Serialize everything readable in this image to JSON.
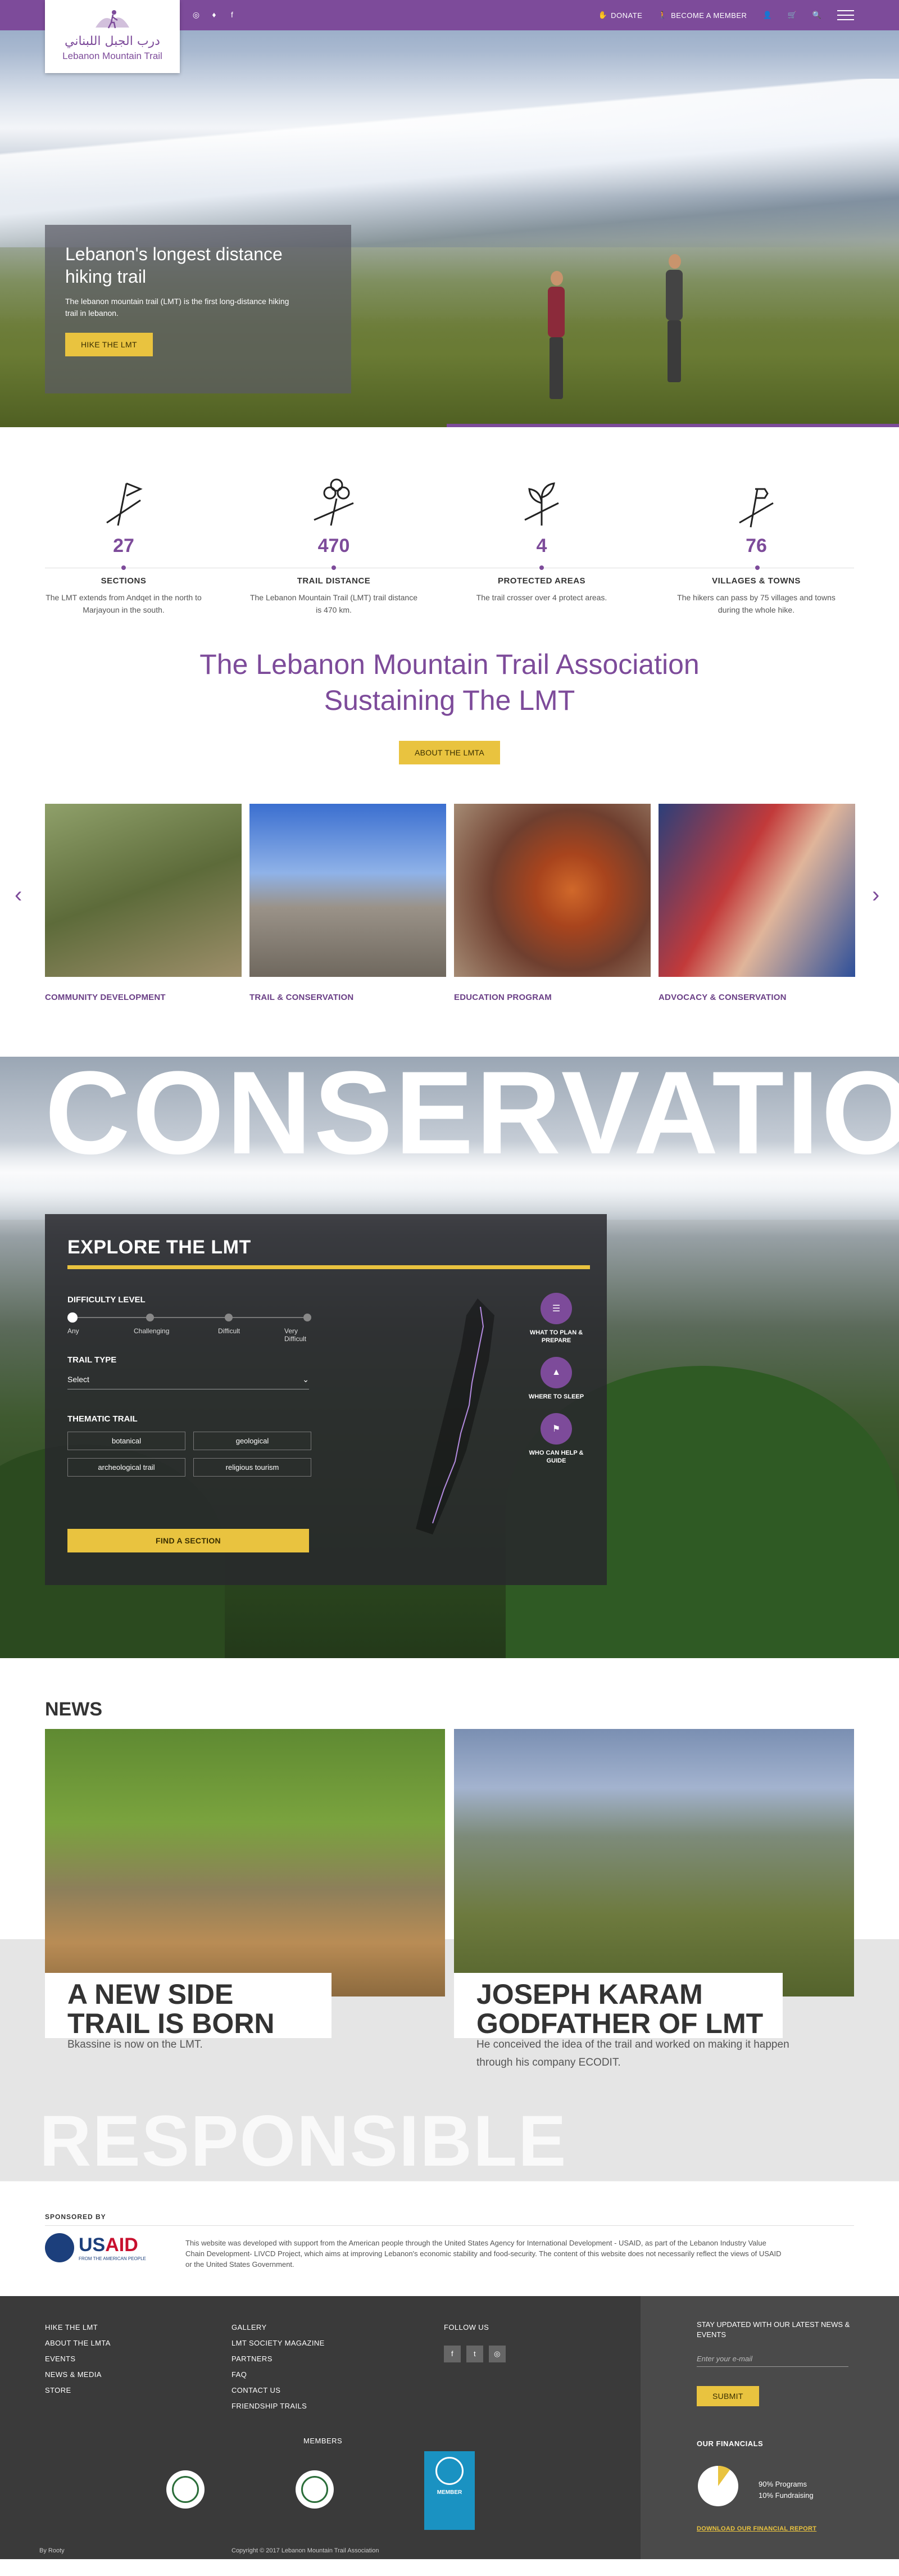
{
  "header": {
    "logo_arabic": "درب الجبل اللبناني",
    "logo_text": "Lebanon Mountain Trail",
    "donate": "DONATE",
    "become_member": "BECOME A MEMBER"
  },
  "hero": {
    "title": "Lebanon's longest distance hiking  trail",
    "body": "The lebanon mountain trail (LMT) is the first long-distance hiking trail in lebanon.",
    "button": "HIKE THE LMT"
  },
  "stats": [
    {
      "num": "27",
      "label": "SECTIONS",
      "desc": "The LMT extends from Andqet in the north  to Marjayoun in the south."
    },
    {
      "num": "470",
      "label": "TRAIL DISTANCE",
      "desc": "The Lebanon Mountain Trail (LMT) trail distance is 470 km."
    },
    {
      "num": "4",
      "label": "PROTECTED AREAS",
      "desc": "The trail crosser over 4 protect areas."
    },
    {
      "num": "76",
      "label": "VILLAGES & TOWNS",
      "desc": "The hikers can pass by 75 villages and towns during the whole hike."
    }
  ],
  "assoc": {
    "line1": "The Lebanon Mountain Trail Association",
    "line2": "Sustaining The LMT",
    "button": "ABOUT THE LMTA"
  },
  "programs": [
    {
      "label": "COMMUNITY DEVELOPMENT"
    },
    {
      "label": "TRAIL & CONSERVATION"
    },
    {
      "label": "EDUCATION PROGRAM"
    },
    {
      "label": "ADVOCACY & CONSERVATION"
    }
  ],
  "explore": {
    "bg_word": "CONSERVATION",
    "title": "EXPLORE THE LMT",
    "difficulty_label": "DIFFICULTY LEVEL",
    "difficulty": [
      "Any",
      "Challenging",
      "Difficult",
      "Very Difficult"
    ],
    "trail_type_label": "TRAIL TYPE",
    "trail_type_value": "Select",
    "thematic_label": "THEMATIC TRAIL",
    "thematic": [
      "botanical",
      "geological",
      "archeological trail",
      "religious tourism"
    ],
    "button": "FIND A SECTION",
    "side": [
      "WHAT TO PLAN & PREPARE",
      "WHERE TO SLEEP",
      "WHO CAN HELP & GUIDE"
    ]
  },
  "news": {
    "heading": "NEWS",
    "items": [
      {
        "title": "A NEW SIDE TRAIL IS BORN",
        "sub": "Bkassine is now on the LMT."
      },
      {
        "title": "JOSEPH KARAM GODFATHER OF LMT",
        "sub": "He conceived the idea of the trail and worked on making it happen through his company ECODIT."
      }
    ],
    "bg_word": "RESPONSIBLE TOURISM"
  },
  "sponsor": {
    "label": "SPONSORED BY",
    "usaid_a": "US",
    "usaid_b": "AID",
    "usaid_tag": "FROM THE AMERICAN PEOPLE",
    "text": "This website was developed with support from the American people through the United States Agency for International Development - USAID, as part of the Lebanon Industry Value Chain Development- LIVCD Project, which aims at improving Lebanon's economic stability and food-security. The content of this website does not necessarily reflect the views of USAID or the United States Government."
  },
  "footer": {
    "col1": [
      "HIKE THE LMT",
      "ABOUT THE LMTA",
      "EVENTS",
      "NEWS & MEDIA",
      "STORE"
    ],
    "col2": [
      "GALLERY",
      "LMT SOCIETY MAGAZINE",
      "PARTNERS",
      "FAQ",
      "CONTACT US",
      "FRIENDSHIP TRAILS"
    ],
    "follow": "FOLLOW US",
    "updated": "STAY UPDATED WITH OUR LATEST NEWS & EVENTS",
    "email_placeholder": "Enter your e-mail",
    "submit": "SUBMIT",
    "financials": "OUR FINANCIALS",
    "pie_programs": "90% Programs",
    "pie_fundraising": "10% Fundraising",
    "pie_data": {
      "programs": 90,
      "fundraising": 10
    },
    "download": "DOWNLOAD OUR FINANCIAL REPORT",
    "members": "MEMBERS",
    "member_badge": "MEMBER",
    "by": "By Rooty",
    "copyright": "Copyright © 2017 Lebanon Mountain Trail Association"
  },
  "colors": {
    "purple": "#7d4b9a",
    "yellow": "#e9c33f",
    "footer": "#3a3a3a"
  }
}
